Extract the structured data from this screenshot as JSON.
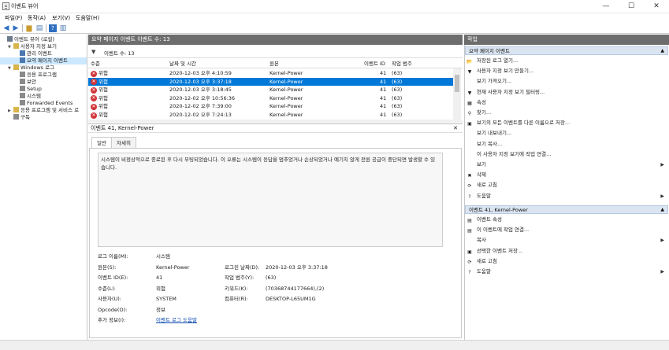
{
  "window": {
    "title": "이벤트 뷰어",
    "minimize": "—",
    "maximize": "☐",
    "close": "✕"
  },
  "menu": [
    "파일(F)",
    "동작(A)",
    "보기(V)",
    "도움말(H)"
  ],
  "tree": [
    {
      "label": "이벤트 뷰어 (로컬)",
      "toggle": "",
      "indent": 0,
      "icon": "#6b7b8c"
    },
    {
      "label": "사용자 지정 보기",
      "toggle": "▼",
      "indent": 1,
      "icon": "#d9b44a"
    },
    {
      "label": "관리 이벤트",
      "toggle": "",
      "indent": 2,
      "icon": "#4a78b0"
    },
    {
      "label": "요약 페이지 이벤트",
      "toggle": "",
      "indent": 2,
      "icon": "#4a78b0",
      "selected": true
    },
    {
      "label": "Windows 로그",
      "toggle": "▼",
      "indent": 1,
      "icon": "#d9b44a"
    },
    {
      "label": "응용 프로그램",
      "toggle": "",
      "indent": 2,
      "icon": "#8a8a8a"
    },
    {
      "label": "보안",
      "toggle": "",
      "indent": 2,
      "icon": "#8a8a8a"
    },
    {
      "label": "Setup",
      "toggle": "",
      "indent": 2,
      "icon": "#8a8a8a"
    },
    {
      "label": "시스템",
      "toggle": "",
      "indent": 2,
      "icon": "#8a8a8a"
    },
    {
      "label": "Forwarded Events",
      "toggle": "",
      "indent": 2,
      "icon": "#8a8a8a"
    },
    {
      "label": "응용 프로그램 및 서비스 로",
      "toggle": "▶",
      "indent": 1,
      "icon": "#d9b44a"
    },
    {
      "label": "구독",
      "toggle": "",
      "indent": 1,
      "icon": "#8a8a8a"
    }
  ],
  "center": {
    "header": "요약 페이지 이벤트     이벤트 수: 13",
    "filter_text": "이벤트 수: 13",
    "columns": [
      "수준",
      "날짜 및 시간",
      "원본",
      "이벤트 ID",
      "작업 범주"
    ],
    "rows": [
      {
        "level": "위험",
        "datetime": "2020-12-03 오후 4:10:59",
        "source": "Kernel-Power",
        "id": "41",
        "category": "(63)"
      },
      {
        "level": "위험",
        "datetime": "2020-12-03 오후 3:37:18",
        "source": "Kernel-Power",
        "id": "41",
        "category": "(63)",
        "selected": true
      },
      {
        "level": "위험",
        "datetime": "2020-12-03 오후 3:18:45",
        "source": "Kernel-Power",
        "id": "41",
        "category": "(63)"
      },
      {
        "level": "위험",
        "datetime": "2020-12-02 오후 10:56:36",
        "source": "Kernel-Power",
        "id": "41",
        "category": "(63)"
      },
      {
        "level": "위험",
        "datetime": "2020-12-02 오후 7:39:00",
        "source": "Kernel-Power",
        "id": "41",
        "category": "(63)"
      },
      {
        "level": "위험",
        "datetime": "2020-12-02 오후 7:24:13",
        "source": "Kernel-Power",
        "id": "41",
        "category": "(63)"
      }
    ]
  },
  "detail": {
    "header": "이벤트 41, Kernel-Power",
    "close": "✕",
    "tabs": [
      "일반",
      "자세히"
    ],
    "message": "시스템이 비정상적으로 종료된 후 다시 부팅되었습니다. 이 오류는 시스템이 응답을 멈추었거나 손상되었거나 예기치 않게 전원 공급이 중단되면 발생할 수 있습니다.",
    "fields": {
      "log_name_label": "로그 이름(M):",
      "log_name": "시스템",
      "source_label": "원본(S):",
      "source": "Kernel-Power",
      "logged_label": "로그된 날짜(D):",
      "logged": "2020-12-03 오후 3:37:18",
      "event_id_label": "이벤트 ID(E):",
      "event_id": "41",
      "task_label": "작업 범주(Y):",
      "task": "(63)",
      "level_label": "수준(L):",
      "level": "위험",
      "keywords_label": "키워드(K):",
      "keywords": "(70368744177664),(2)",
      "user_label": "사용자(U):",
      "user": "SYSTEM",
      "computer_label": "컴퓨터(R):",
      "computer": "DESKTOP-L65UM1G",
      "opcode_label": "Opcode(O):",
      "opcode": "정보",
      "more_label": "추가 정보(I):",
      "more_link": "이벤트 로그 도움말"
    }
  },
  "actions": {
    "header": "작업",
    "section1": "요약 페이지 이벤트",
    "items1": [
      {
        "label": "저장된 로그 열기...",
        "icon": "📂",
        "arrow": ""
      },
      {
        "label": "사용자 지정 보기 만들기...",
        "icon": "▼",
        "arrow": ""
      },
      {
        "label": "보기 가져오기...",
        "icon": "",
        "arrow": ""
      },
      {
        "label": "현재 사용자 지정 보기 필터링...",
        "icon": "▼",
        "arrow": ""
      },
      {
        "label": "속성",
        "icon": "▦",
        "arrow": ""
      },
      {
        "label": "찾기...",
        "icon": "⚲",
        "arrow": ""
      },
      {
        "label": "보기의 모든 이벤트를 다른 이름으로 저장...",
        "icon": "▣",
        "arrow": ""
      },
      {
        "label": "보기 내보내기...",
        "icon": "",
        "arrow": ""
      },
      {
        "label": "보기 복사...",
        "icon": "",
        "arrow": ""
      },
      {
        "label": "이 사용자 지정 보기에 작업 연결...",
        "icon": "",
        "arrow": ""
      },
      {
        "label": "보기",
        "icon": "",
        "arrow": "▶"
      },
      {
        "label": "삭제",
        "icon": "✖",
        "arrow": ""
      },
      {
        "label": "새로 고침",
        "icon": "⟳",
        "arrow": ""
      },
      {
        "label": "도움말",
        "icon": "?",
        "arrow": "▶"
      }
    ],
    "section2": "이벤트 41, Kernel-Power",
    "items2": [
      {
        "label": "이벤트 속성",
        "icon": "▤",
        "arrow": ""
      },
      {
        "label": "이 이벤트에 작업 연결...",
        "icon": "▤",
        "arrow": ""
      },
      {
        "label": "복사",
        "icon": "",
        "arrow": "▶"
      },
      {
        "label": "선택한 이벤트 저장...",
        "icon": "▣",
        "arrow": ""
      },
      {
        "label": "새로 고침",
        "icon": "⟳",
        "arrow": ""
      },
      {
        "label": "도움말",
        "icon": "?",
        "arrow": "▶"
      }
    ]
  }
}
